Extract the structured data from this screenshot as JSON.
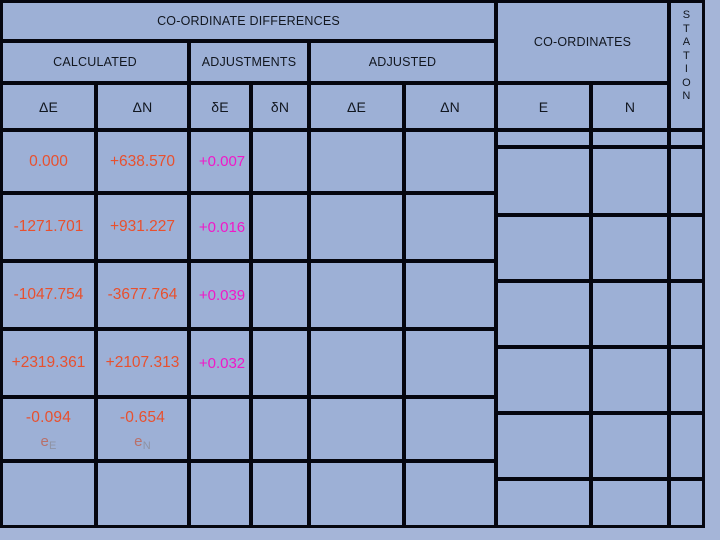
{
  "table": {
    "group_headers": {
      "coordinate_differences": "CO-ORDINATE DIFFERENCES",
      "coordinates": "CO-ORDINATES",
      "station": "STATION",
      "station_letters": [
        "S",
        "T",
        "A",
        "T",
        "I",
        "O",
        "N"
      ]
    },
    "sub_group_headers": {
      "calculated": "CALCULATED",
      "adjustments": "ADJUSTMENTS",
      "adjusted": "ADJUSTED"
    },
    "column_headers": {
      "calc_de": "ΔE",
      "calc_dn": "ΔN",
      "adjust_de": "δE",
      "adjust_dn": "δN",
      "adjusted_de": "ΔE",
      "adjusted_dn": "ΔN",
      "coord_e": "E",
      "coord_n": "N"
    },
    "colors": {
      "cell_fill": "#9db0d6",
      "grid_line": "#05060f",
      "page_background": "#a5b5d8",
      "header_text": "#11161f",
      "calculated_value": "#e8502e",
      "adjustment_value": "#f018c8",
      "misclose_label": "#b8706a",
      "misclose_subscript": "#8e93a4"
    },
    "rows": [
      {
        "calc_de": "0.000",
        "calc_dn": "+638.570",
        "adjust_de": "+0.007",
        "adjust_dn": "",
        "adjusted_de": "",
        "adjusted_dn": "",
        "coord_e": "",
        "coord_n": "",
        "station": ""
      },
      {
        "calc_de": "-1271.701",
        "calc_dn": "+931.227",
        "adjust_de": "+0.016",
        "adjust_dn": "",
        "adjusted_de": "",
        "adjusted_dn": "",
        "coord_e": "",
        "coord_n": "",
        "station": ""
      },
      {
        "calc_de": "-1047.754",
        "calc_dn": "-3677.764",
        "adjust_de": "+0.039",
        "adjust_dn": "",
        "adjusted_de": "",
        "adjusted_dn": "",
        "coord_e": "",
        "coord_n": "",
        "station": ""
      },
      {
        "calc_de": "+2319.361",
        "calc_dn": "+2107.313",
        "adjust_de": "+0.032",
        "adjust_dn": "",
        "adjusted_de": "",
        "adjusted_dn": "",
        "coord_e": "",
        "coord_n": "",
        "station": ""
      },
      {
        "calc_de": "-0.094",
        "calc_de_label": "e",
        "calc_de_sub": "E",
        "calc_dn": "-0.654",
        "calc_dn_label": "e",
        "calc_dn_sub": "N",
        "adjust_de": "",
        "adjust_dn": "",
        "adjusted_de": "",
        "adjusted_dn": "",
        "coord_e": "",
        "coord_n": "",
        "station": ""
      },
      {
        "calc_de": "",
        "calc_dn": "",
        "adjust_de": "",
        "adjust_dn": "",
        "adjusted_de": "",
        "adjusted_dn": "",
        "coord_e": "",
        "coord_n": "",
        "station": ""
      }
    ]
  }
}
